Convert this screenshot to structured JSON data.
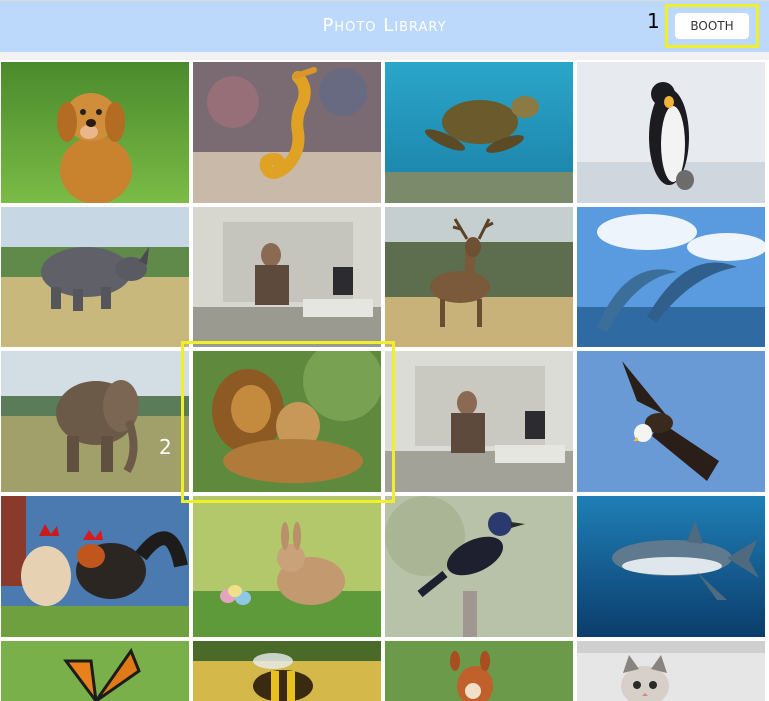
{
  "header": {
    "title": "Photo Library",
    "booth_label": "BOOTH",
    "bg": "#bcd8fb"
  },
  "annotations": [
    {
      "label": "1",
      "color": "#000000"
    },
    {
      "label": "2",
      "color": "#ffffff"
    }
  ],
  "highlight_color": "#f0f02a",
  "photos": [
    {
      "subject": "golden retriever dog",
      "icon": "dog-icon"
    },
    {
      "subject": "seahorse",
      "icon": "seahorse-icon"
    },
    {
      "subject": "sea turtle",
      "icon": "turtle-icon"
    },
    {
      "subject": "penguins",
      "icon": "penguin-icon"
    },
    {
      "subject": "rhinoceros",
      "icon": "rhino-icon"
    },
    {
      "subject": "man at office desk",
      "icon": "office-icon"
    },
    {
      "subject": "deer stag",
      "icon": "deer-icon"
    },
    {
      "subject": "dolphins jumping",
      "icon": "dolphin-icon"
    },
    {
      "subject": "elephant",
      "icon": "elephant-icon"
    },
    {
      "subject": "lion and lioness",
      "icon": "lion-icon"
    },
    {
      "subject": "man at office desk",
      "icon": "office-icon"
    },
    {
      "subject": "bald eagle",
      "icon": "eagle-icon"
    },
    {
      "subject": "rooster and hen",
      "icon": "rooster-icon"
    },
    {
      "subject": "rabbit with easter eggs",
      "icon": "rabbit-icon"
    },
    {
      "subject": "blackbird on post",
      "icon": "bird-icon"
    },
    {
      "subject": "great white shark",
      "icon": "shark-icon"
    },
    {
      "subject": "monarch butterfly",
      "icon": "butterfly-icon"
    },
    {
      "subject": "bee on flower",
      "icon": "bee-icon"
    },
    {
      "subject": "squirrel",
      "icon": "squirrel-icon"
    },
    {
      "subject": "kitten",
      "icon": "kitten-icon"
    }
  ]
}
